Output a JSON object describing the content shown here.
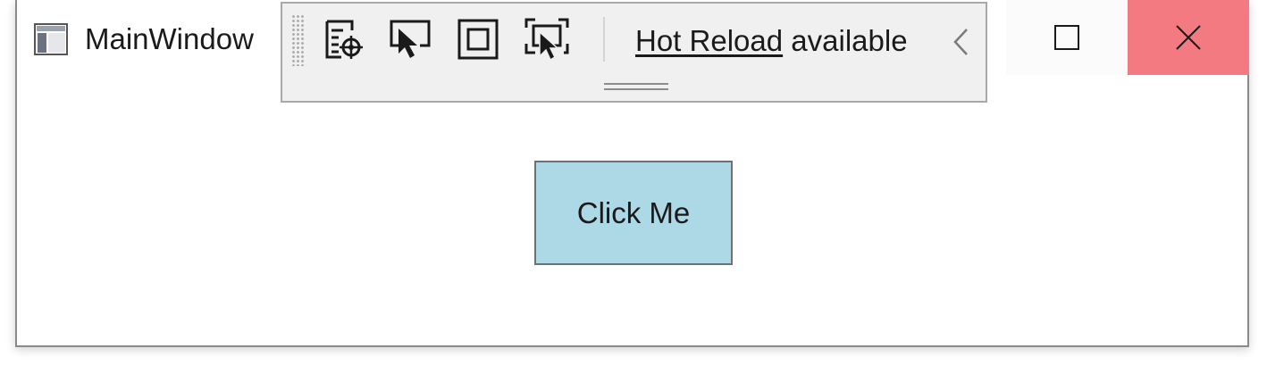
{
  "window": {
    "title": "MainWindow",
    "app_icon": "window-app-icon",
    "controls": {
      "maximize_icon": "maximize-icon",
      "close_icon": "close-icon",
      "close_color": "#f47a82"
    }
  },
  "toolbar": {
    "tools": [
      {
        "icon": "go-to-live-visual-tree-icon"
      },
      {
        "icon": "select-element-icon"
      },
      {
        "icon": "display-layout-adorners-icon"
      },
      {
        "icon": "track-focused-element-icon"
      }
    ],
    "hot_reload_link": "Hot Reload",
    "hot_reload_status": "available",
    "collapse_icon": "chevron-left-icon"
  },
  "content": {
    "button_label": "Click Me",
    "button_color": "#add8e6"
  }
}
